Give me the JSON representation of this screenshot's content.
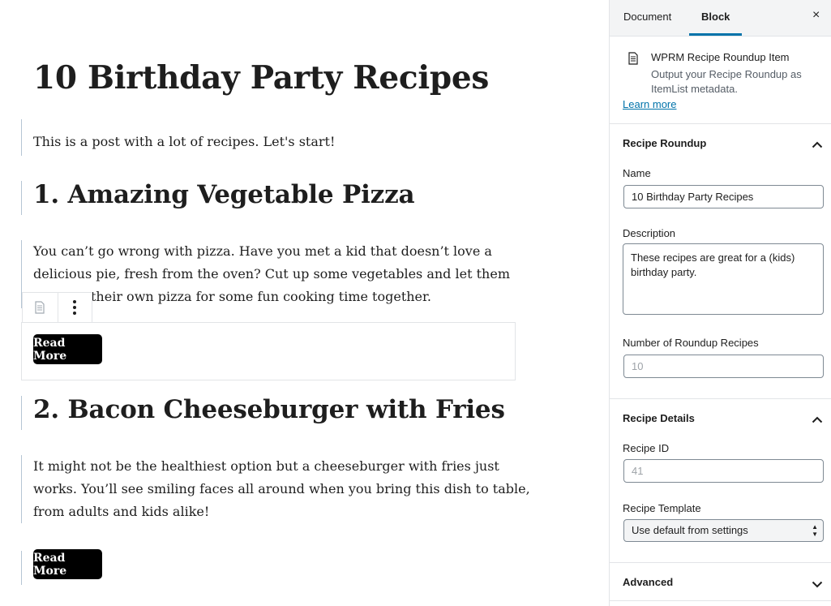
{
  "post": {
    "title": "10 Birthday Party Recipes",
    "intro": "This is a post with a lot of recipes. Let's start!",
    "recipes": [
      {
        "heading": "1. Amazing Vegetable Pizza",
        "lines": [
          "You can’t go wrong with pizza. Have you met a kid that doesn’t love a",
          "delicious pie, fresh from the oven? Cut up some vegetables and let them",
          "their own pizza for some fun cooking time together."
        ],
        "button": "Read More"
      },
      {
        "heading": "2. Bacon Cheeseburger with Fries",
        "lines": [
          "It might not be the healthiest option but a cheeseburger with fries just",
          "works. You’ll see smiling faces all around when you bring this dish to table,",
          "from adults and kids alike!"
        ],
        "button": "Read More"
      }
    ]
  },
  "block_toolbar": {
    "icons": [
      "block-type-icon",
      "more-options-icon"
    ]
  },
  "sidebar": {
    "tabs": [
      "Document",
      "Block"
    ],
    "active_tab": "Block",
    "close": "×",
    "block_card": {
      "icon": "document-icon",
      "title": "WPRM Recipe Roundup Item",
      "description": "Output your Recipe Roundup as ItemList metadata.",
      "learn_more": "Learn more"
    },
    "recipe_roundup": {
      "title": "Recipe Roundup",
      "name_label": "Name",
      "name_value": "10 Birthday Party Recipes",
      "description_label": "Description",
      "description_value": "These recipes are great for a (kids) birthday party.",
      "number_label": "Number of Roundup Recipes",
      "number_placeholder": "10"
    },
    "recipe_details": {
      "title": "Recipe Details",
      "recipe_id_label": "Recipe ID",
      "recipe_id_placeholder": "41",
      "template_label": "Recipe Template",
      "template_value": "Use default from settings"
    },
    "advanced": {
      "title": "Advanced"
    }
  },
  "colors": {
    "accent": "#0073aa",
    "button_bg": "#000000",
    "text": "#1e1e1e",
    "border": "#e2e4e7"
  }
}
